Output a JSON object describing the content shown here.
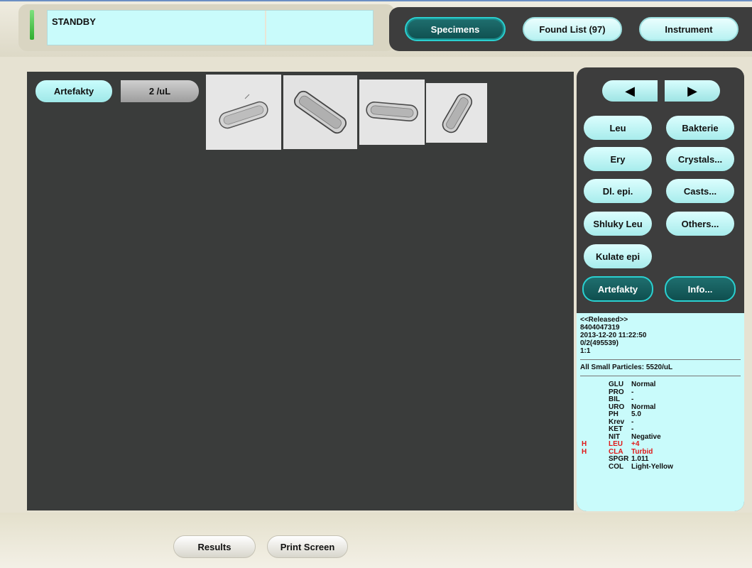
{
  "status": {
    "text": "STANDBY"
  },
  "nav": {
    "specimens": "Specimens",
    "found_list": "Found List (97)",
    "instrument": "Instrument"
  },
  "viewer": {
    "class_label": "Artefakty",
    "count": "2 /uL",
    "thumbnails": [
      "cast-1",
      "cast-2",
      "cast-3",
      "cast-4"
    ]
  },
  "categories": {
    "prev_icon": "left-arrow-icon",
    "next_icon": "right-arrow-icon",
    "leu": "Leu",
    "bakterie": "Bakterie",
    "ery": "Ery",
    "crystals": "Crystals...",
    "dl_epi": "Dl. epi.",
    "casts": "Casts...",
    "shluky_leu": "Shluky Leu",
    "others": "Others...",
    "kulate_epi": "Kulate epi",
    "artefakty": "Artefakty",
    "info": "Info..."
  },
  "specimen_info": {
    "state": "<<Released>>",
    "id": "8404047319",
    "datetime": "2013-12-20 11:22:50",
    "rack": "0/2(495539)",
    "dilution": "1:1",
    "small_particles": "All Small Particles: 5520/uL",
    "tests": [
      {
        "flag": "",
        "name": "GLU",
        "value": "Normal",
        "high": false
      },
      {
        "flag": "",
        "name": "PRO",
        "value": "-",
        "high": false
      },
      {
        "flag": "",
        "name": "BIL",
        "value": "-",
        "high": false
      },
      {
        "flag": "",
        "name": "URO",
        "value": "Normal",
        "high": false
      },
      {
        "flag": "",
        "name": "PH",
        "value": "5.0",
        "high": false
      },
      {
        "flag": "",
        "name": "Krev",
        "value": "-",
        "high": false
      },
      {
        "flag": "",
        "name": "KET",
        "value": "-",
        "high": false
      },
      {
        "flag": "",
        "name": "NIT",
        "value": "Negative",
        "high": false
      },
      {
        "flag": "H",
        "name": "LEU",
        "value": "+4",
        "high": true
      },
      {
        "flag": "H",
        "name": "CLA",
        "value": "Turbid",
        "high": true
      },
      {
        "flag": "",
        "name": "SPGR",
        "value": "1.011",
        "high": false
      },
      {
        "flag": "",
        "name": "COL",
        "value": "Light-Yellow",
        "high": false
      }
    ]
  },
  "footer": {
    "results": "Results",
    "print_screen": "Print Screen"
  },
  "colors": {
    "panel_dark": "#3d3d3d",
    "cyan_light": "#c9fbfb",
    "active_teal": "#0f4f4f",
    "high_flag": "#e01818"
  }
}
